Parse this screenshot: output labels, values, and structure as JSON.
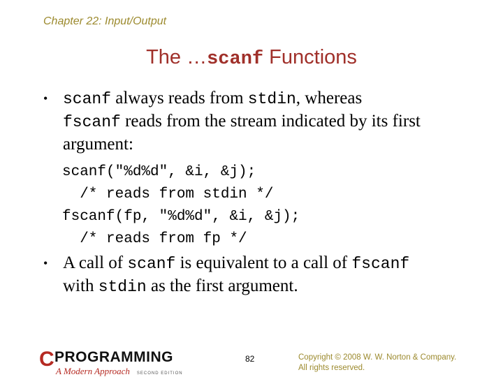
{
  "header": {
    "chapter": "Chapter 22: Input/Output"
  },
  "slide": {
    "title_prefix": "The …",
    "title_code": "scanf",
    "title_suffix": " Functions",
    "bullet1": {
      "code1": "scanf",
      "text1": " always reads from ",
      "code2": "stdin",
      "text2": ", whereas",
      "code3": "fscanf",
      "text3": " reads from the stream indicated by its first argument:"
    },
    "code_lines": [
      "scanf(\"%d%d\", &i, &j);",
      "  /* reads from stdin */",
      "fscanf(fp, \"%d%d\", &i, &j);",
      "  /* reads from fp */"
    ],
    "bullet2": {
      "text1": "A call of ",
      "code1": "scanf",
      "text2": " is equivalent to a call of ",
      "code2": "fscanf",
      "text3": "with ",
      "code3": "stdin",
      "text4": " as the first argument."
    },
    "bullet_glyph": "•"
  },
  "footer": {
    "logo_c": "C",
    "logo_title": "PROGRAMMING",
    "logo_subtitle": "A Modern Approach",
    "logo_edition": "SECOND EDITION",
    "page_number": "82",
    "copyright_line1": "Copyright © 2008 W. W. Norton & Company.",
    "copyright_line2": "All rights reserved."
  }
}
